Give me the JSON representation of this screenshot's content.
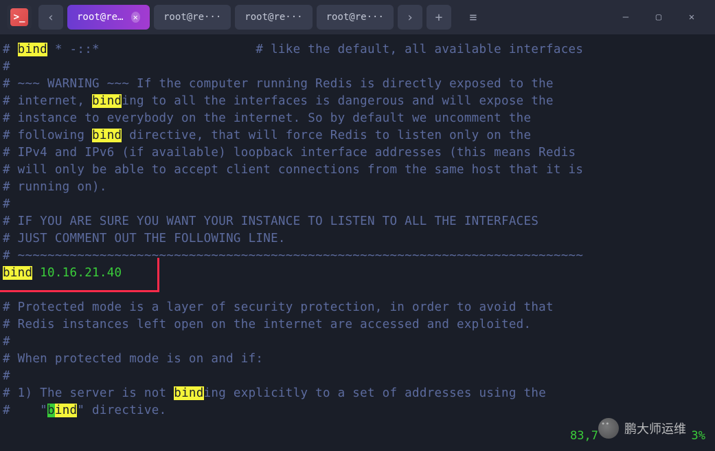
{
  "titlebar": {
    "app_icon_glyph": ">_",
    "nav_back": "‹",
    "nav_forward": "›",
    "new_tab": "+",
    "menu": "≡",
    "minimize": "—",
    "maximize": "▢",
    "close": "✕"
  },
  "tabs": [
    {
      "label": "root@re···",
      "active": true
    },
    {
      "label": "root@re···",
      "active": false
    },
    {
      "label": "root@re···",
      "active": false
    },
    {
      "label": "root@re···",
      "active": false
    }
  ],
  "terminal": {
    "lines": [
      {
        "seg": [
          {
            "t": "# ",
            "c": "hash"
          },
          {
            "t": "bind",
            "c": "hl"
          },
          {
            "t": " * -::*                     # like the default, all available interfaces",
            "c": "hash"
          }
        ]
      },
      {
        "seg": [
          {
            "t": "#",
            "c": "hash"
          }
        ]
      },
      {
        "seg": [
          {
            "t": "# ~~~ WARNING ~~~ If the computer running Redis is directly exposed to the",
            "c": "hash"
          }
        ]
      },
      {
        "seg": [
          {
            "t": "# internet, ",
            "c": "hash"
          },
          {
            "t": "bind",
            "c": "hl"
          },
          {
            "t": "ing to all the interfaces is dangerous and will expose the",
            "c": "hash"
          }
        ]
      },
      {
        "seg": [
          {
            "t": "# instance to everybody on the internet. So by default we uncomment the",
            "c": "hash"
          }
        ]
      },
      {
        "seg": [
          {
            "t": "# following ",
            "c": "hash"
          },
          {
            "t": "bind",
            "c": "hl"
          },
          {
            "t": " directive, that will force Redis to listen only on the",
            "c": "hash"
          }
        ]
      },
      {
        "seg": [
          {
            "t": "# IPv4 and IPv6 (if available) loopback interface addresses (this means Redis",
            "c": "hash"
          }
        ]
      },
      {
        "seg": [
          {
            "t": "# will only be able to accept client connections from the same host that it is",
            "c": "hash"
          }
        ]
      },
      {
        "seg": [
          {
            "t": "# running on).",
            "c": "hash"
          }
        ]
      },
      {
        "seg": [
          {
            "t": "#",
            "c": "hash"
          }
        ]
      },
      {
        "seg": [
          {
            "t": "# IF YOU ARE SURE YOU WANT YOUR INSTANCE TO LISTEN TO ALL THE INTERFACES",
            "c": "hash"
          }
        ]
      },
      {
        "seg": [
          {
            "t": "# JUST COMMENT OUT THE FOLLOWING LINE.",
            "c": "hash"
          }
        ]
      },
      {
        "seg": [
          {
            "t": "# ~~~~~~~~~~~~~~~~~~~~~~~~~~~~~~~~~~~~~~~~~~~~~~~~~~~~~~~~~~~~~~~~~~~~~~~~~~~~",
            "c": "hash"
          }
        ]
      },
      {
        "seg": [
          {
            "t": "bind",
            "c": "hl"
          },
          {
            "t": " 10.16.21.40",
            "c": "green"
          }
        ]
      },
      {
        "seg": [
          {
            "t": "",
            "c": ""
          }
        ]
      },
      {
        "seg": [
          {
            "t": "# Protected mode is a layer of security protection, in order to avoid that",
            "c": "hash"
          }
        ]
      },
      {
        "seg": [
          {
            "t": "# Redis instances left open on the internet are accessed and exploited.",
            "c": "hash"
          }
        ]
      },
      {
        "seg": [
          {
            "t": "#",
            "c": "hash"
          }
        ]
      },
      {
        "seg": [
          {
            "t": "# When protected mode is on and if:",
            "c": "hash"
          }
        ]
      },
      {
        "seg": [
          {
            "t": "#",
            "c": "hash"
          }
        ]
      },
      {
        "seg": [
          {
            "t": "# 1) The server is not ",
            "c": "hash"
          },
          {
            "t": "bind",
            "c": "hl"
          },
          {
            "t": "ing explicitly to a set of addresses using the",
            "c": "hash"
          }
        ]
      },
      {
        "seg": [
          {
            "t": "#    \"",
            "c": "hash"
          },
          {
            "t": "b",
            "c": "cursor-hl"
          },
          {
            "t": "ind",
            "c": "hl"
          },
          {
            "t": "\" directive.",
            "c": "hash"
          }
        ]
      }
    ]
  },
  "status": {
    "position": "83,7",
    "percent": "3%"
  },
  "watermark": {
    "text": "鹏大师运维"
  }
}
